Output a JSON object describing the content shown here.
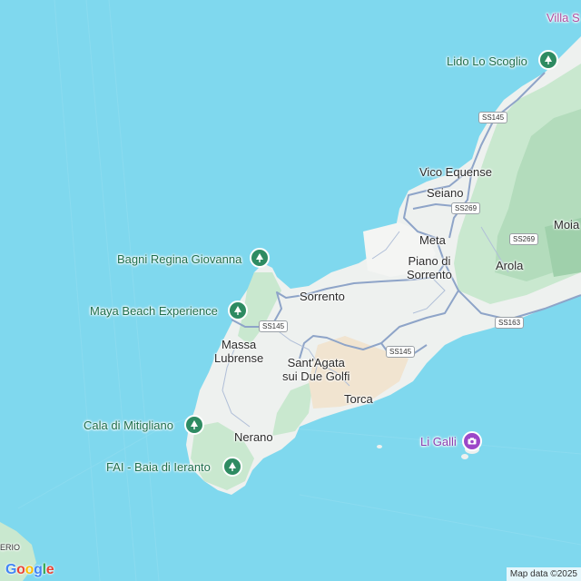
{
  "map": {
    "colors": {
      "sea": "#7fd8ee",
      "land": "#eef1ef",
      "green": "#c9e8cf",
      "darkgreen": "#a8d6b3",
      "road": "#8ea4c8",
      "sand": "#f1e4d0"
    },
    "labels": {
      "villa": "Villa S",
      "lido": "Lido Lo Scoglio",
      "vico": "Vico Equense",
      "seiano": "Seiano",
      "moia": "Moia",
      "meta": "Meta",
      "piano_1": "Piano di",
      "piano_2": "Sorrento",
      "arola": "Arola",
      "bagni": "Bagni Regina Giovanna",
      "sorrento": "Sorrento",
      "maya": "Maya Beach Experience",
      "massa_1": "Massa",
      "massa_2": "Lubrense",
      "santagata_1": "Sant'Agata",
      "santagata_2": "sui Due Golfi",
      "torca": "Torca",
      "mitigliano": "Cala di Mitigliano",
      "nerano": "Nerano",
      "ligalli": "Li Galli",
      "ieranto": "FAI - Baia di Ieranto",
      "erio": "ERIO"
    },
    "roads": {
      "ss145_a": "SS145",
      "ss269_a": "SS269",
      "ss269_b": "SS269",
      "ss163": "SS163",
      "ss145_b": "SS145",
      "ss145_c": "SS145"
    },
    "icons": {
      "lido": "park-pin-icon",
      "bagni": "park-pin-icon",
      "maya": "park-pin-icon",
      "mitigliano": "park-pin-icon",
      "ieranto": "park-pin-icon",
      "ligalli": "camera-pin-icon"
    },
    "attribution": "Map data ©2025",
    "logo": "Google"
  }
}
